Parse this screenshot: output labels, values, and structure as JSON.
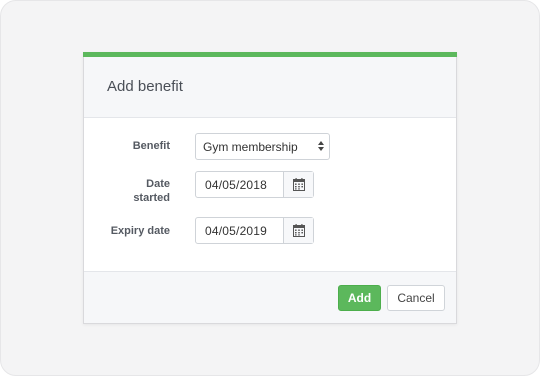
{
  "modal": {
    "title": "Add benefit",
    "accent_color": "#5cb85c"
  },
  "form": {
    "benefit": {
      "label": "Benefit",
      "value": "Gym membership"
    },
    "date_started": {
      "label_line1": "Date",
      "label_line2": "started",
      "value": "04/05/2018",
      "icon": "calendar-icon"
    },
    "expiry_date": {
      "label": "Expiry date",
      "value": "04/05/2019",
      "icon": "calendar-icon"
    }
  },
  "footer": {
    "add_label": "Add",
    "cancel_label": "Cancel"
  }
}
